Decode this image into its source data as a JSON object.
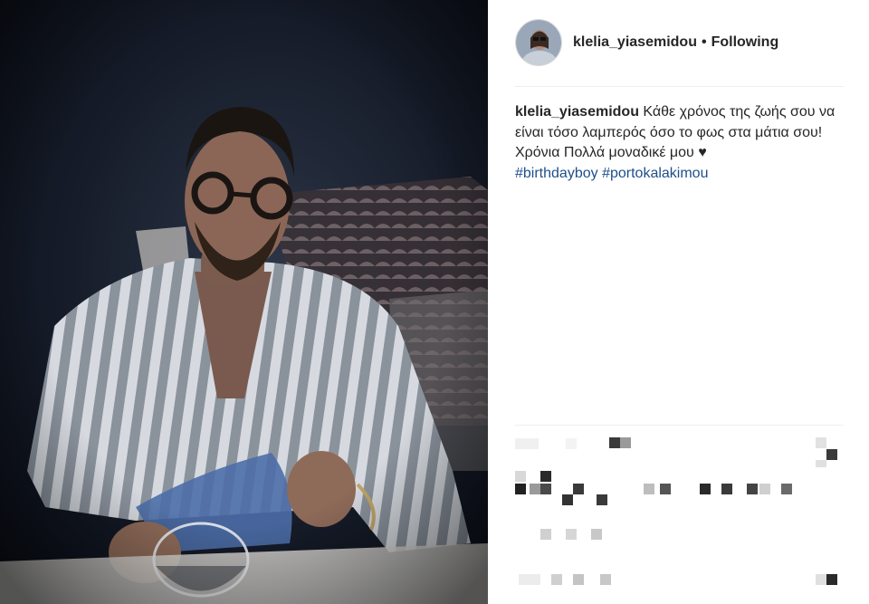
{
  "header": {
    "username": "klelia_yiasemidou",
    "separator": "•",
    "follow_status": "Following"
  },
  "caption": {
    "username": "klelia_yiasemidou",
    "text": "Κάθε χρόνος της ζωής σου να είναι τόσο λαμπερός όσο το φως στα μάτια σου! Χρόνια Πολλά μοναδικέ μου",
    "heart": "♥",
    "hashtags": [
      "#birthdayboy",
      "#portokalakimou"
    ]
  },
  "comments": {
    "pixelated": true
  },
  "colors": {
    "hashtag": "#1f4e89",
    "text": "#262626",
    "divider": "#efefef"
  },
  "icons": {
    "heart": "heart-icon"
  }
}
